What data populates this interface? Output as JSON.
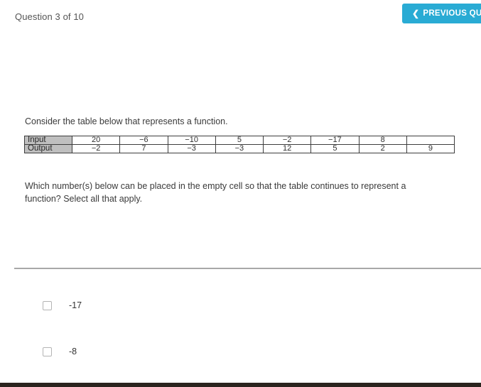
{
  "header": {
    "question_counter": "Question 3 of 10",
    "previous_button": {
      "label": "PREVIOUS QUESTION",
      "chevron": "❮",
      "color": "#29abd4"
    }
  },
  "main": {
    "intro_text": "Consider the table below that represents a function.",
    "question_text": "Which number(s) below can be placed in the empty cell so that the table continues to represent a function? Select all that apply.",
    "table": {
      "header_fill": "#bfbfbf",
      "rows": [
        {
          "label": "Input",
          "cells": [
            "20",
            "−6",
            "−10",
            "5",
            "−2",
            "−17",
            "8",
            ""
          ]
        },
        {
          "label": "Output",
          "cells": [
            "−2",
            "7",
            "−3",
            "−3",
            "12",
            "5",
            "2",
            "9"
          ]
        }
      ]
    }
  },
  "answers": {
    "options": [
      {
        "label": "-17",
        "checked": false
      },
      {
        "label": "-8",
        "checked": false
      }
    ]
  }
}
